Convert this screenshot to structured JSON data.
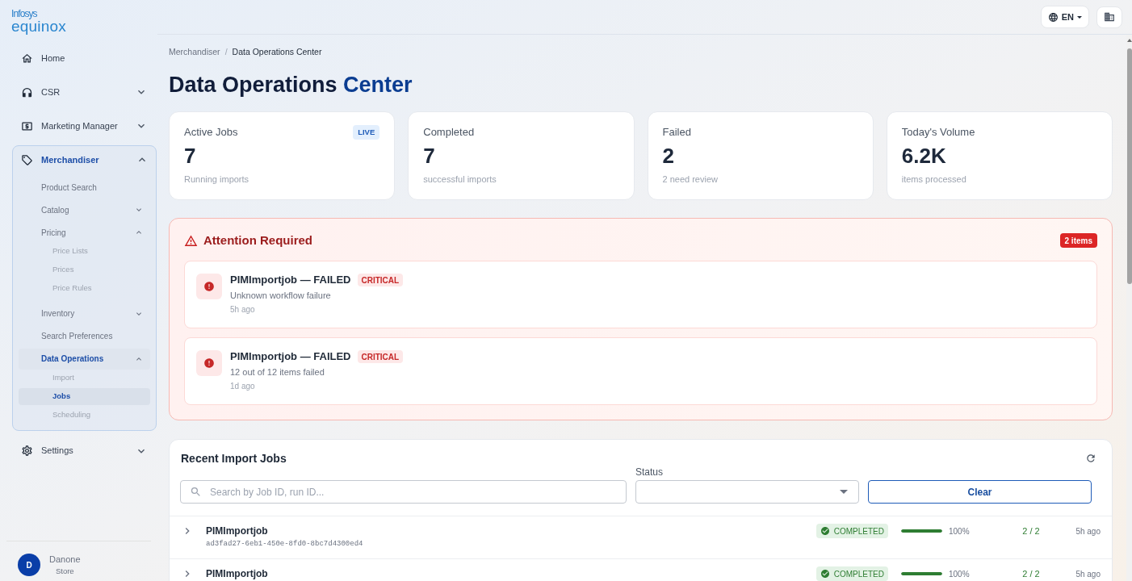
{
  "sidebar": {
    "logo": {
      "brand": "Infosys",
      "product": "equinox"
    },
    "nav": [
      {
        "label": "Home",
        "selected": false
      },
      {
        "label": "CSR",
        "selected": false,
        "expanded": false
      },
      {
        "label": "Marketing Manager",
        "selected": false,
        "expanded": false
      },
      {
        "label": "Merchandiser",
        "selected": false,
        "expanded": true,
        "children": [
          {
            "label": "Product Search",
            "selected": false
          },
          {
            "label": "Catalog",
            "selected": false,
            "expanded": false
          },
          {
            "label": "Pricing",
            "selected": false,
            "expanded": true,
            "children": [
              {
                "label": "Price Lists",
                "selected": false
              },
              {
                "label": "Prices",
                "selected": false
              },
              {
                "label": "Price Rules",
                "selected": false
              }
            ]
          },
          {
            "label": "Inventory",
            "selected": false,
            "expanded": false
          },
          {
            "label": "Search Preferences",
            "selected": false
          },
          {
            "label": "Data Operations",
            "selected": false,
            "expanded": true,
            "children": [
              {
                "label": "Import",
                "selected": false
              },
              {
                "label": "Jobs",
                "selected": true
              },
              {
                "label": "Scheduling",
                "selected": false
              }
            ]
          }
        ]
      },
      {
        "label": "Settings",
        "selected": false,
        "expanded": false
      }
    ],
    "user": {
      "initial": "D",
      "name": "Danone",
      "role": "Store"
    }
  },
  "top_bar": {
    "language": "EN"
  },
  "breadcrumb": {
    "items": [
      "Merchandiser",
      "Data Operations Center"
    ],
    "separator": "/"
  },
  "title": {
    "text": "Data Operations",
    "accent": "Center"
  },
  "stats": [
    {
      "label": "Active Jobs",
      "value": "7",
      "caption": "Running imports",
      "badge": "LIVE"
    },
    {
      "label": "Completed",
      "value": "7",
      "caption": "successful imports"
    },
    {
      "label": "Failed",
      "value": "2",
      "caption": "2 need review"
    },
    {
      "label": "Today's Volume",
      "value": "6.2K",
      "caption": "items processed"
    }
  ],
  "attention": {
    "title": "Attention Required",
    "count": "2 items",
    "alerts": [
      {
        "title": "PIMImportjob — FAILED",
        "severity": "CRITICAL",
        "message": "Unknown workflow failure",
        "time": "5h ago"
      },
      {
        "title": "PIMImportjob — FAILED",
        "severity": "CRITICAL",
        "message": "12 out of 12 items failed",
        "time": "1d ago"
      }
    ]
  },
  "jobs": {
    "title": "Recent Import Jobs",
    "search": {
      "placeholder": "Search by Job ID, run ID..."
    },
    "status_filter": {
      "label": "Status"
    },
    "clear_button": "Clear",
    "rows": [
      {
        "name": "PIMImportjob",
        "run_id": "ad3fad27-6eb1-450e-8fd0-8bc7d4300ed4",
        "expanded": false,
        "status": {
          "label": "COMPLETED",
          "kind": "success"
        },
        "level": 1,
        "percent": "100%",
        "count": "2 / 2",
        "time": "5h ago"
      },
      {
        "name": "PIMImportjob",
        "expanded": false,
        "status": {
          "label": "COMPLETED",
          "kind": "success"
        },
        "level": 1,
        "percent": "100%",
        "count": "2 / 2",
        "time": "5h ago"
      }
    ]
  }
}
